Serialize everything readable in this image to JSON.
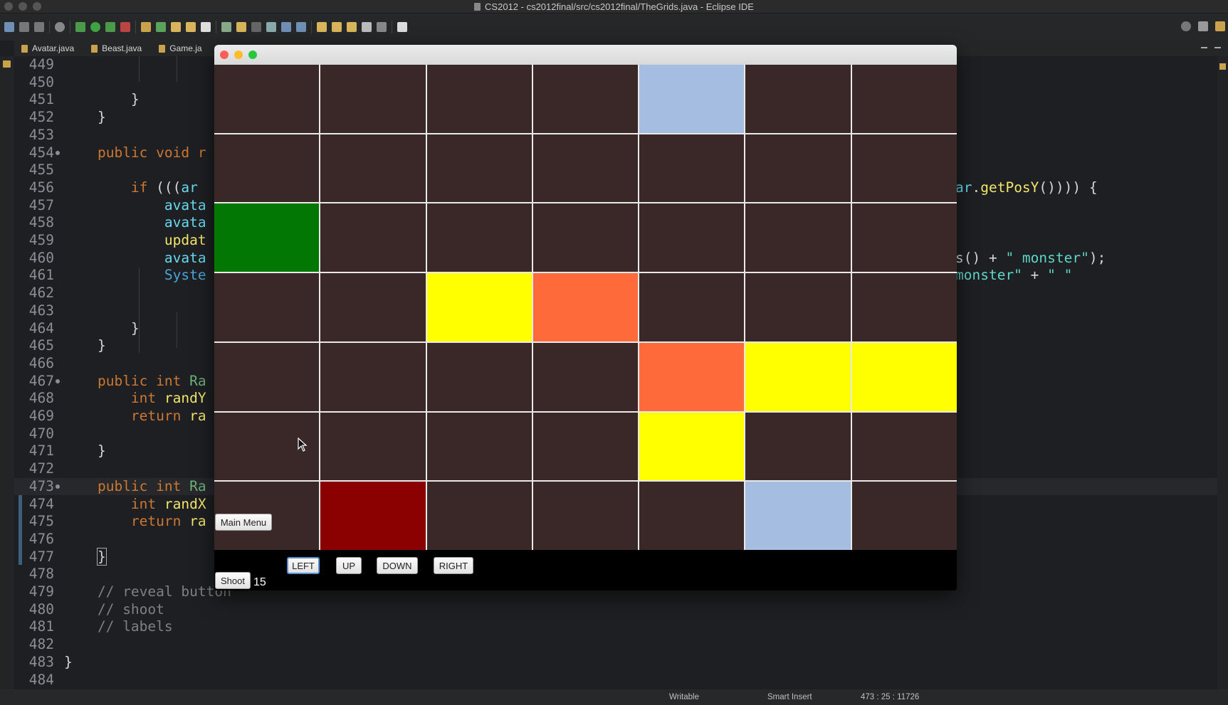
{
  "window": {
    "title": "CS2012 - cs2012final/src/cs2012final/TheGrids.java - Eclipse IDE"
  },
  "editor_tabs": [
    {
      "label": "Avatar.java"
    },
    {
      "label": "Beast.java"
    },
    {
      "label": "Game.ja"
    }
  ],
  "code_lines": [
    {
      "n": "449",
      "html": ""
    },
    {
      "n": "450",
      "html": ""
    },
    {
      "n": "451",
      "html": "        }"
    },
    {
      "n": "452",
      "html": "    }"
    },
    {
      "n": "453",
      "html": ""
    },
    {
      "n": "454",
      "html": "    <span class=\"kw\">public void</span> <span class=\"kw\">r</span>"
    },
    {
      "n": "455",
      "html": ""
    },
    {
      "n": "456",
      "html": "        <span class=\"kw\">if</span> (((<span class=\"fld\">ar</span>"
    },
    {
      "n": "457",
      "html": "            <span class=\"fld\">avata</span>"
    },
    {
      "n": "458",
      "html": "            <span class=\"fld\">avata</span>"
    },
    {
      "n": "459",
      "html": "            <span class=\"mth\">updat</span>"
    },
    {
      "n": "460",
      "html": "            <span class=\"fld\">avata</span>"
    },
    {
      "n": "461",
      "html": "            <span class=\"fld\" style=\"color:#4aa3d8\">Syste</span>"
    },
    {
      "n": "462",
      "html": ""
    },
    {
      "n": "463",
      "html": ""
    },
    {
      "n": "464",
      "html": "        }"
    },
    {
      "n": "465",
      "html": "    }"
    },
    {
      "n": "466",
      "html": ""
    },
    {
      "n": "467",
      "html": "    <span class=\"kw\">public int</span> <span class=\"gl\">Ra</span>"
    },
    {
      "n": "468",
      "html": "        <span class=\"kw\">int</span> <span class=\"mth\">randY</span>"
    },
    {
      "n": "469",
      "html": "        <span class=\"kw\">return</span> <span class=\"mth\">ra</span>"
    },
    {
      "n": "470",
      "html": ""
    },
    {
      "n": "471",
      "html": "    }"
    },
    {
      "n": "472",
      "html": ""
    },
    {
      "n": "473",
      "html": "    <span class=\"kw\">public int</span> <span class=\"gl\">Ra</span>"
    },
    {
      "n": "474",
      "html": "        <span class=\"kw\">int</span> <span class=\"mth\">randX</span>"
    },
    {
      "n": "475",
      "html": "        <span class=\"kw\">return</span> <span class=\"mth\">ra</span>"
    },
    {
      "n": "476",
      "html": ""
    },
    {
      "n": "477",
      "html": "    <span style=\"outline:1px solid #aaa\">}</span>"
    },
    {
      "n": "478",
      "html": ""
    },
    {
      "n": "479",
      "html": "    <span class=\"cmt\">// reveal button</span>"
    },
    {
      "n": "480",
      "html": "    <span class=\"cmt\">// shoot</span>"
    },
    {
      "n": "481",
      "html": "    <span class=\"cmt\">// labels</span>"
    },
    {
      "n": "482",
      "html": ""
    },
    {
      "n": "483",
      "html": "}"
    },
    {
      "n": "484",
      "html": ""
    }
  ],
  "code_right_fragments": [
    {
      "line": "456",
      "html": "<span class=\"fld\">ar</span>.<span class=\"mth\">getPosY</span>()))) {"
    },
    {
      "line": "460",
      "html": "s() + <span class=\"str\">\" monster\"</span>);"
    },
    {
      "line": "461",
      "html": "<span class=\"str\">monster\"</span> + <span class=\"str\">\" \"</span>"
    }
  ],
  "game": {
    "grid_rows": 7,
    "grid_cols": 7,
    "cells": [
      {
        "row": 0,
        "col": 4,
        "color": "#a4bde1",
        "kind": "light-blue"
      },
      {
        "row": 2,
        "col": 0,
        "color": "#037703",
        "kind": "green"
      },
      {
        "row": 3,
        "col": 2,
        "color": "#ffff00",
        "kind": "yellow"
      },
      {
        "row": 3,
        "col": 3,
        "color": "#ff6a3a",
        "kind": "orange"
      },
      {
        "row": 4,
        "col": 4,
        "color": "#ff6a3a",
        "kind": "orange"
      },
      {
        "row": 4,
        "col": 5,
        "color": "#ffff00",
        "kind": "yellow"
      },
      {
        "row": 4,
        "col": 6,
        "color": "#ffff00",
        "kind": "yellow"
      },
      {
        "row": 5,
        "col": 4,
        "color": "#ffff00",
        "kind": "yellow"
      },
      {
        "row": 6,
        "col": 1,
        "color": "#8b0000",
        "kind": "dark-red"
      },
      {
        "row": 6,
        "col": 5,
        "color": "#a4bde1",
        "kind": "light-blue"
      }
    ],
    "empty_cell_color": "#3a2727",
    "main_menu_label": "Main Menu",
    "left_label": "LEFT",
    "up_label": "UP",
    "down_label": "DOWN",
    "right_label": "RIGHT",
    "shoot_label": "Shoot",
    "ammo": "15"
  },
  "status": {
    "writable": "Writable",
    "insert_mode": "Smart Insert",
    "position": "473 : 25 : 11726"
  }
}
